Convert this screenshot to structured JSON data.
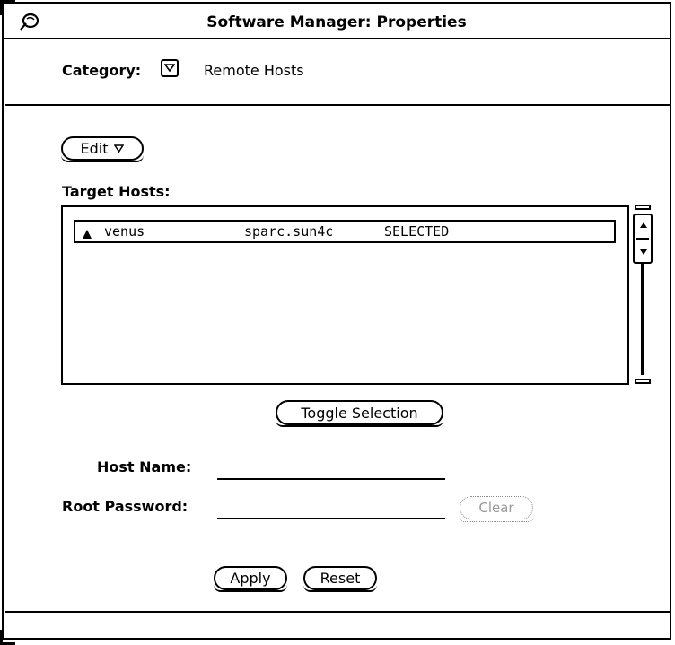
{
  "window": {
    "title": "Software Manager: Properties",
    "menu_icon": "window-menu-icon"
  },
  "category": {
    "label": "Category:",
    "menu_icon": "menu-triangle-icon",
    "value": "Remote Hosts"
  },
  "edit_button": {
    "label": "Edit",
    "icon": "menu-triangle-icon"
  },
  "target_hosts": {
    "label": "Target Hosts:",
    "rows": [
      {
        "icon": "host-glyph-icon",
        "name": "venus",
        "arch": "sparc.sun4c",
        "status": "SELECTED"
      }
    ]
  },
  "toggle_button": {
    "label": "Toggle Selection"
  },
  "fields": {
    "host_name_label": "Host Name:",
    "host_name_value": "",
    "root_password_label": "Root Password:",
    "root_password_value": ""
  },
  "clear_button": {
    "label": "Clear",
    "enabled": false
  },
  "footer": {
    "apply_label": "Apply",
    "reset_label": "Reset"
  }
}
